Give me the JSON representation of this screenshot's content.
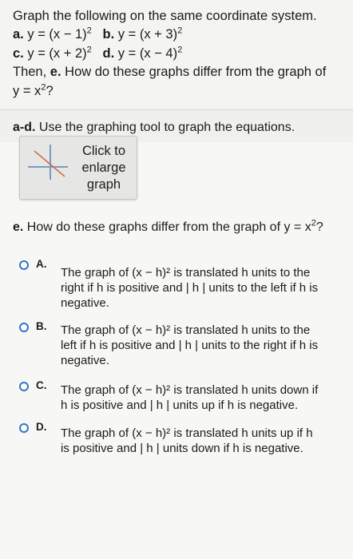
{
  "question": {
    "line1": "Graph the following on the same coordinate system.",
    "a_label": "a.",
    "a_eq": "y = (x − 1)",
    "b_label": "b.",
    "b_eq": "y = (x + 3)",
    "c_label": "c.",
    "c_eq": "y = (x + 2)",
    "d_label": "d.",
    "d_eq": "y = (x − 4)",
    "exponent": "2",
    "then_pre": "Then,",
    "then_e": "e.",
    "then_rest": "How do these graphs differ from the graph of",
    "line4_base": "y = x",
    "line4_q": "?"
  },
  "section_ad": {
    "label_bold": "a-d.",
    "label_rest": "Use the graphing tool to graph the equations."
  },
  "graph_button": {
    "line1": "Click to",
    "line2": "enlarge",
    "line3": "graph"
  },
  "part_e": {
    "label_bold": "e.",
    "text": "How do these graphs differ from the graph of y = x",
    "q": "?"
  },
  "options": [
    {
      "letter": "A.",
      "lines": [
        "The graph of (x − h)² is translated h units to the",
        "right if h is positive and | h | units to the left if h is",
        "negative."
      ]
    },
    {
      "letter": "B.",
      "lines": [
        "The graph of (x − h)² is translated h units to the",
        "left if h is positive and | h | units to the right if h is",
        "negative."
      ]
    },
    {
      "letter": "C.",
      "lines": [
        "The graph of (x − h)² is translated h units down if",
        "h is positive and | h | units up if h is negative."
      ]
    },
    {
      "letter": "D.",
      "lines": [
        "The graph of (x − h)² is translated h units up if h",
        "is positive and | h | units down if h is negative."
      ]
    }
  ],
  "colors": {
    "radio_border": "#2f77c8",
    "thumb_axis": "#7a9bc0",
    "thumb_line": "#d06a4a"
  }
}
